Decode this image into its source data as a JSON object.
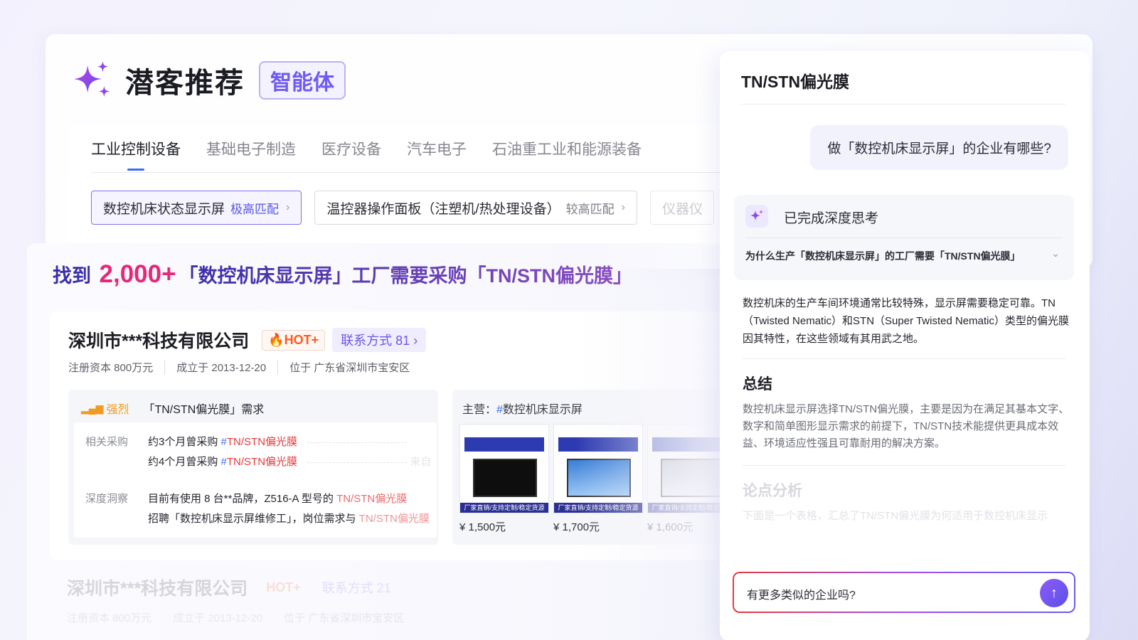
{
  "header": {
    "title": "潜客推荐",
    "badge": "智能体"
  },
  "tabs": [
    {
      "label": "工业控制设备",
      "active": true
    },
    {
      "label": "基础电子制造"
    },
    {
      "label": "医疗设备"
    },
    {
      "label": "汽车电子"
    },
    {
      "label": "石油重工业和能源装备"
    }
  ],
  "chips": [
    {
      "label": "数控机床状态显示屏",
      "match": "极高匹配"
    },
    {
      "label": "温控器操作面板（注塑机/热处理设备）",
      "match": "较高匹配"
    },
    {
      "label": "仪器仪"
    }
  ],
  "found": {
    "prefix": "找到",
    "count": "2,000+",
    "rest": "「数控机床显示屏」工厂需要采购「TN/STN偏光膜」"
  },
  "company": {
    "name": "深圳市***科技有限公司",
    "hot": "HOT+",
    "contact": "联系方式 81",
    "meta": [
      "注册资本 800万元",
      "成立于 2013-12-20",
      "位于 广东省深圳市宝安区"
    ],
    "need": {
      "level": "强烈",
      "title": "「TN/STN偏光膜」需求",
      "purchase_label": "相关采购",
      "purchase": [
        {
          "text": "约3个月曾采购",
          "tag": "TN/STN偏光膜"
        },
        {
          "text": "约4个月曾采购",
          "tag": "TN/STN偏光膜",
          "extra": "来自"
        }
      ],
      "insight_label": "深度洞察",
      "insights": [
        {
          "text": "目前有使用 8 台**品牌，Z516-A 型号的 ",
          "tag": "TN/STN偏光膜"
        },
        {
          "text": "招聘「数控机床显示屏维修工」，岗位需求与 ",
          "tag": "TN/STN偏光膜"
        }
      ]
    },
    "products": {
      "label": "主营：",
      "tag": "数控机床显示屏",
      "band": "厂家直销/支持定制/稳定货源",
      "items": [
        {
          "price": "¥ 1,500元"
        },
        {
          "price": "¥ 1,700元"
        },
        {
          "price": "¥ 1,600元"
        }
      ]
    }
  },
  "company2": {
    "name": "深圳市***科技有限公司",
    "hot": "HOT+",
    "contact": "联系方式 21",
    "meta": "注册资本 800万元　　成立于 2013-12-20　　位于 广东省深圳市宝安区"
  },
  "panel": {
    "title": "TN/STN偏光膜",
    "user_question": "做「数控机床显示屏」的企业有哪些?",
    "thinking_title": "已完成深度思考",
    "thinking_question": "为什么生产「数控机床显示屏」的工厂需要「TN/STN偏光膜」",
    "answer": "数控机床的生产车间环境通常比较特殊，显示屏需要稳定可靠。TN（Twisted Nematic）和STN（Super Twisted Nematic）类型的偏光膜因其特性，在这些领域有其用武之地。",
    "summary_heading": "总结",
    "summary": "数控机床显示屏选择TN/STN偏光膜，主要是因为在满足其基本文字、数字和简单图形显示需求的前提下，TN/STN技术能提供更具成本效益、环境适应性强且可靠耐用的解决方案。",
    "analysis_heading": "论点分析",
    "analysis": "下面是一个表格，汇总了TN/STN偏光膜为何适用于数控机床显示",
    "input_value": "有更多类似的企业吗?"
  }
}
